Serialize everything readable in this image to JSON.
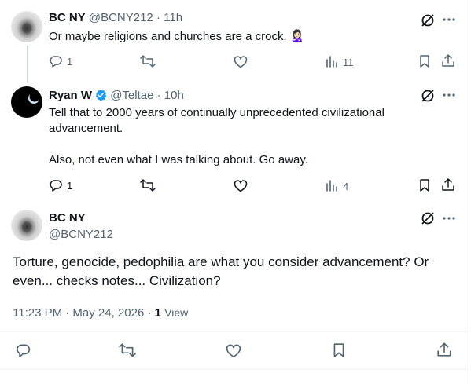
{
  "colors": {
    "text_primary": "#0f1419",
    "text_secondary": "#536471",
    "verified_blue": "#1d9bf0",
    "border": "#eff3f4"
  },
  "tweets": [
    {
      "name": "BC NY",
      "handle": "@BCNY212",
      "separator": "·",
      "time": "11h",
      "text": "Or maybe religions and churches are a crock. 🙎🏻‍♀️",
      "replies": "1",
      "views": "11"
    },
    {
      "name": "Ryan W",
      "verified": true,
      "handle": "@Teltae",
      "separator": "·",
      "time": "10h",
      "text_line1": "Tell that to 2000 years of continually unprecedented civilizational advancement.",
      "text_line2": "Also, not even what I was talking about. Go away.",
      "replies": "1",
      "views": "4"
    }
  ],
  "main_tweet": {
    "name": "BC NY",
    "handle": "@BCNY212",
    "text": "Torture, genocide, pedophilia are what you consider advancement? Or even... checks notes... Civilization?",
    "timestamp": "11:23 PM · May 24, 2026",
    "separator": "·",
    "view_count": "1",
    "view_label": "View"
  }
}
